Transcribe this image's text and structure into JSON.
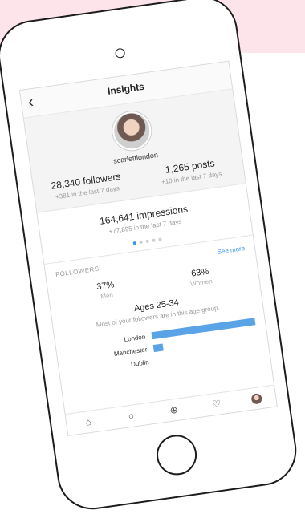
{
  "header": {
    "back_icon": "‹",
    "title": "Insights"
  },
  "profile": {
    "username": "scarlettlondon",
    "followers": "28,340 followers",
    "followers_change": "+381 in the last 7 days",
    "posts": "1,265 posts",
    "posts_change": "+10 in the last 7 days"
  },
  "impressions": {
    "value": "164,641 impressions",
    "change": "+77,895 in the last 7 days",
    "pager": {
      "pages": 5,
      "active": 0
    }
  },
  "followers_section": {
    "label": "FOLLOWERS",
    "see_more": "See more",
    "gender": [
      {
        "pct": "37%",
        "label": "Men"
      },
      {
        "pct": "63%",
        "label": "Women"
      }
    ],
    "age_title": "Ages 25-34",
    "age_subtitle": "Most of your followers are in this age group.",
    "cities": [
      {
        "name": "London",
        "value": 1.0
      },
      {
        "name": "Manchester",
        "value": 0.09
      },
      {
        "name": "Dublin",
        "value": 0.0
      }
    ]
  },
  "nav": [
    {
      "icon": "home-icon",
      "glyph": "⌂"
    },
    {
      "icon": "search-icon",
      "glyph": "○"
    },
    {
      "icon": "add-post-icon",
      "glyph": "⊕"
    },
    {
      "icon": "heart-icon",
      "glyph": "♡"
    },
    {
      "icon": "profile-avatar-icon",
      "glyph": ""
    }
  ],
  "colors": {
    "accent": "#3897f0",
    "bar": "#5aa3e6",
    "band": "#fce4ea"
  }
}
